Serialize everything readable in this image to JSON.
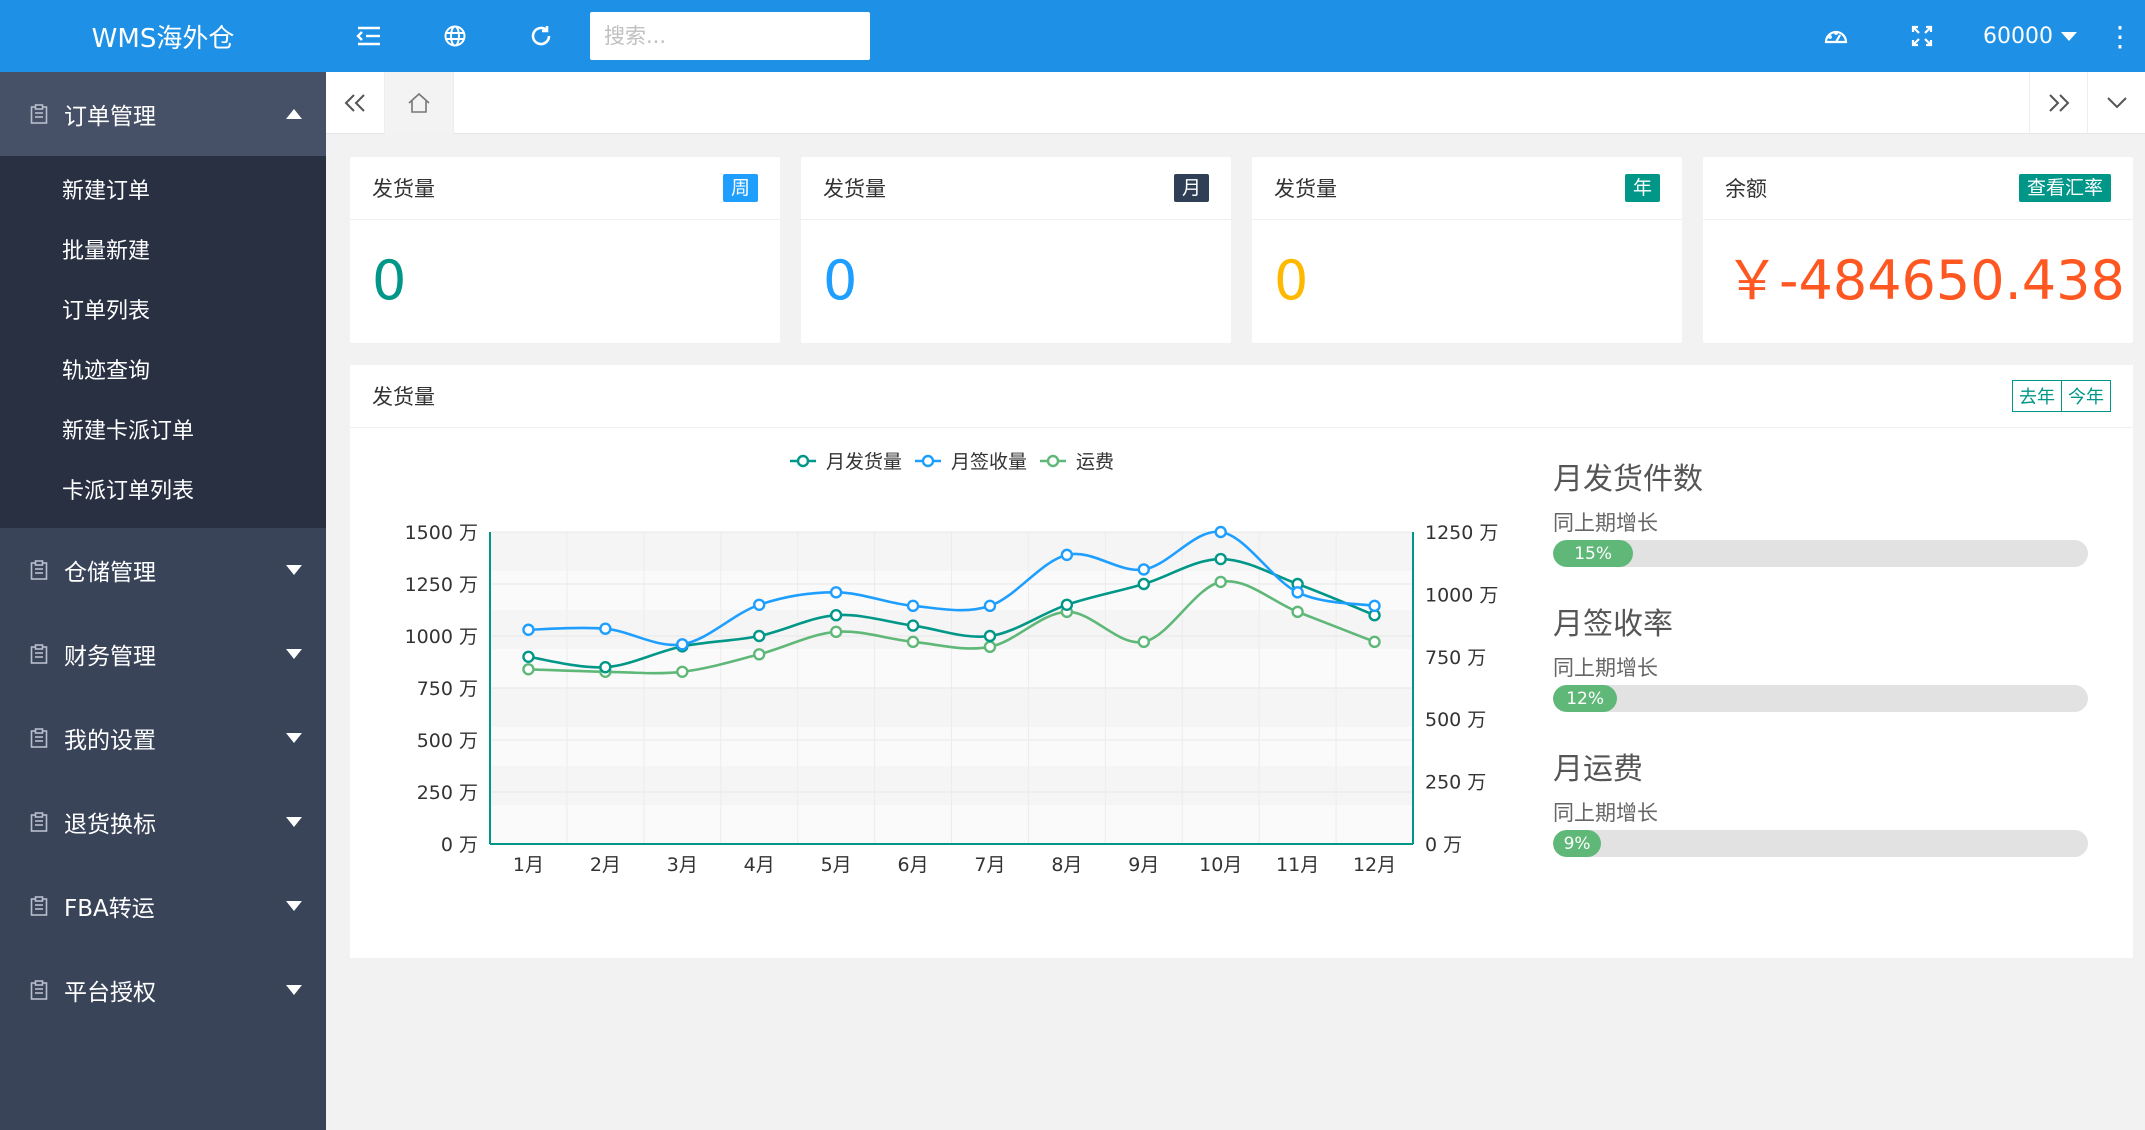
{
  "app": {
    "title": "WMS海外仓"
  },
  "sidebar": {
    "groups": [
      {
        "label": "订单管理",
        "icon": "clipboard-icon",
        "open": true,
        "items": [
          "新建订单",
          "批量新建",
          "订单列表",
          "轨迹查询",
          "新建卡派订单",
          "卡派订单列表"
        ]
      },
      {
        "label": "仓储管理",
        "icon": "clipboard-icon",
        "open": false
      },
      {
        "label": "财务管理",
        "icon": "clipboard-icon",
        "open": false
      },
      {
        "label": "我的设置",
        "icon": "clipboard-icon",
        "open": false
      },
      {
        "label": "退货换标",
        "icon": "clipboard-icon",
        "open": false
      },
      {
        "label": "FBA转运",
        "icon": "clipboard-icon",
        "open": false
      },
      {
        "label": "平台授权",
        "icon": "clipboard-icon",
        "open": false
      }
    ]
  },
  "topbar": {
    "search_placeholder": "搜索...",
    "user": "60000",
    "more": "⋮"
  },
  "cards": [
    {
      "title": "发货量",
      "badge": "周",
      "badge_color": "#1e9fff",
      "value": "0",
      "value_color": "#009688"
    },
    {
      "title": "发货量",
      "badge": "月",
      "badge_color": "#2f4056",
      "value": "0",
      "value_color": "#1e9fff"
    },
    {
      "title": "发货量",
      "badge": "年",
      "badge_color": "#009688",
      "value": "0",
      "value_color": "#ffb800"
    },
    {
      "title": "余额",
      "badge": "查看汇率",
      "badge_color": "#009688",
      "value": "￥-484650.438",
      "value_color": "#ff5722"
    }
  ],
  "panel": {
    "title": "发货量",
    "toggle": [
      "去年",
      "今年"
    ]
  },
  "chart_data": {
    "type": "line",
    "categories": [
      "1月",
      "2月",
      "3月",
      "4月",
      "5月",
      "6月",
      "7月",
      "8月",
      "9月",
      "10月",
      "11月",
      "12月"
    ],
    "series": [
      {
        "name": "月发货量",
        "axis": "left",
        "color": "#009688",
        "values": [
          900,
          850,
          950,
          1000,
          1100,
          1050,
          1000,
          1150,
          1250,
          1370,
          1250,
          1100
        ]
      },
      {
        "name": "月签收量",
        "axis": "left",
        "color": "#1e9fff",
        "values": [
          1030,
          1035,
          960,
          1150,
          1210,
          1145,
          1145,
          1390,
          1320,
          1500,
          1210,
          1145
        ]
      },
      {
        "name": "运费",
        "axis": "right",
        "color": "#5fb878",
        "values": [
          700,
          690,
          690,
          760,
          850,
          810,
          790,
          930,
          810,
          1050,
          930,
          810
        ]
      }
    ],
    "y_left": {
      "min": 0,
      "max": 1500,
      "ticks": [
        "0 万",
        "250 万",
        "500 万",
        "750 万",
        "1000 万",
        "1250 万",
        "1500 万"
      ]
    },
    "y_right": {
      "min": 0,
      "max": 1250,
      "ticks": [
        "0 万",
        "250 万",
        "500 万",
        "750 万",
        "1000 万",
        "1250 万"
      ]
    },
    "legend_position": "top"
  },
  "stats": [
    {
      "title": "月发货件数",
      "sub": "同上期增长",
      "percent": 15,
      "label": "15%"
    },
    {
      "title": "月签收率",
      "sub": "同上期增长",
      "percent": 12,
      "label": "12%"
    },
    {
      "title": "月运费",
      "sub": "同上期增长",
      "percent": 9,
      "label": "9%"
    }
  ]
}
